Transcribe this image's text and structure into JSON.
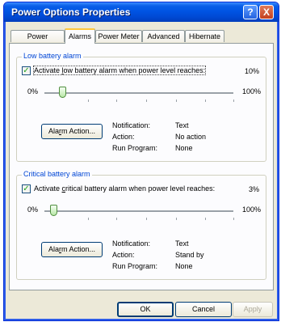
{
  "window": {
    "title": "Power Options Properties"
  },
  "titlebar_buttons": {
    "help": "?",
    "close": "X"
  },
  "tabs": [
    {
      "label": "Power Schemes"
    },
    {
      "label": "Alarms"
    },
    {
      "label": "Power Meter"
    },
    {
      "label": "Advanced"
    },
    {
      "label": "Hibernate"
    }
  ],
  "low_alarm": {
    "group_title": "Low battery alarm",
    "checkbox_pre": "Activate ",
    "checkbox_u": "l",
    "checkbox_post": "ow battery alarm when power level reaches:",
    "checked": true,
    "current_value": "10%",
    "slider_min": "0%",
    "slider_max": "100%",
    "slider_level_percent": 10,
    "action_button_pre": "Ala",
    "action_button_u": "r",
    "action_button_post": "m Action...",
    "notification_label": "Notification:",
    "notification_value": "Text",
    "action_label": "Action:",
    "action_value": "No action",
    "run_program_label": "Run Program:",
    "run_program_value": "None"
  },
  "critical_alarm": {
    "group_title": "Critical battery alarm",
    "checkbox_pre": "Activate ",
    "checkbox_u": "c",
    "checkbox_post": "ritical battery alarm when power level reaches:",
    "checked": true,
    "current_value": "3%",
    "slider_min": "0%",
    "slider_max": "100%",
    "slider_level_percent": 3,
    "action_button_pre": "Ala",
    "action_button_u": "r",
    "action_button_post": "m Action...",
    "notification_label": "Notification:",
    "notification_value": "Text",
    "action_label": "Action:",
    "action_value": "Stand by",
    "run_program_label": "Run Program:",
    "run_program_value": "None"
  },
  "footer": {
    "ok": "OK",
    "cancel": "Cancel",
    "apply": "Apply"
  },
  "colors": {
    "title_bar": "#0054e3",
    "group_title": "#0046d5",
    "active_tab_accent": "#ffc83c"
  }
}
